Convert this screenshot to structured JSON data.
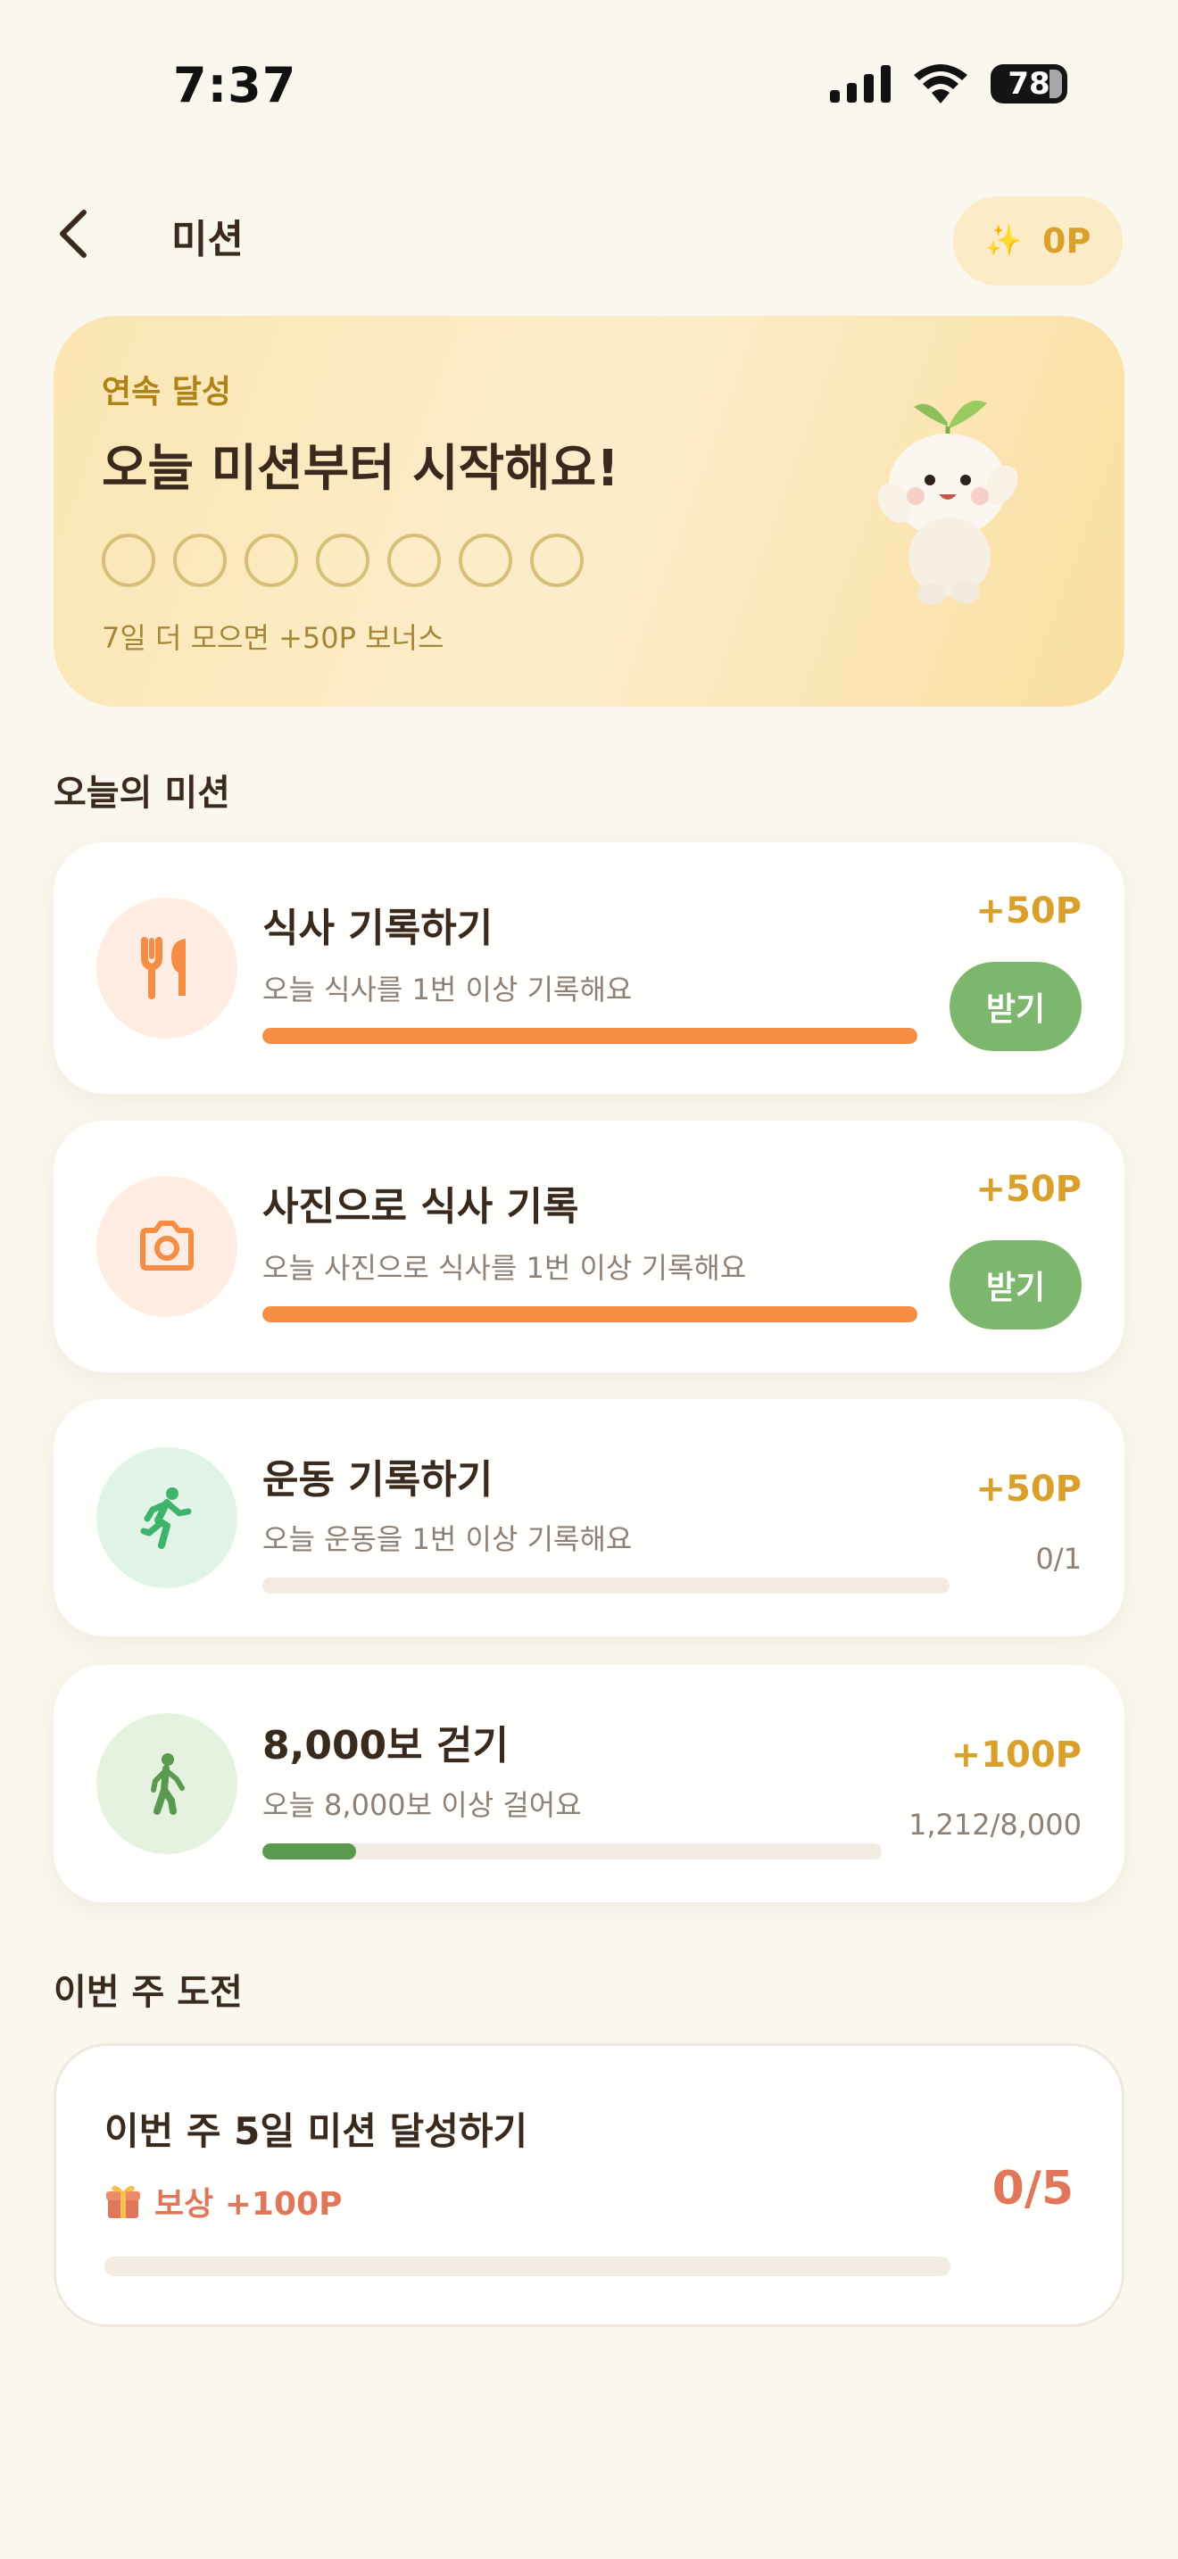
{
  "status_bar": {
    "time": "7:37",
    "battery": "78"
  },
  "header": {
    "title": "미션",
    "points": "0P"
  },
  "streak": {
    "label": "연속 달성",
    "title": "오늘 미션부터 시작해요!",
    "days_total": 7,
    "days_done": 0,
    "bonus_text": "7일 더 모으면 +50P 보너스"
  },
  "today": {
    "section_title": "오늘의 미션",
    "missions": [
      {
        "icon": "fork-knife-icon",
        "title": "식사 기록하기",
        "desc": "오늘 식사를 1번 이상 기록해요",
        "reward": "+50P",
        "action": "받기",
        "progress": 1.0
      },
      {
        "icon": "camera-icon",
        "title": "사진으로 식사 기록",
        "desc": "오늘 사진으로 식사를 1번 이상 기록해요",
        "reward": "+50P",
        "action": "받기",
        "progress": 1.0
      },
      {
        "icon": "running-icon",
        "title": "운동 기록하기",
        "desc": "오늘 운동을 1번 이상 기록해요",
        "reward": "+50P",
        "count": "0/1",
        "progress": 0.0
      },
      {
        "icon": "walking-icon",
        "title": "8,000보 걷기",
        "desc": "오늘 8,000보 이상 걸어요",
        "reward": "+100P",
        "count": "1,212/8,000",
        "progress": 0.1515
      }
    ]
  },
  "weekly": {
    "section_title": "이번 주 도전",
    "title": "이번 주 5일 미션 달성하기",
    "reward": "보상 +100P",
    "count": "0/5",
    "progress": 0.0
  },
  "colors": {
    "accent_gold": "#D9A12B",
    "claim_green": "#7DB66D",
    "progress_orange": "#F68D45",
    "progress_green": "#5A9A4F",
    "challenge_coral": "#E0765A"
  }
}
